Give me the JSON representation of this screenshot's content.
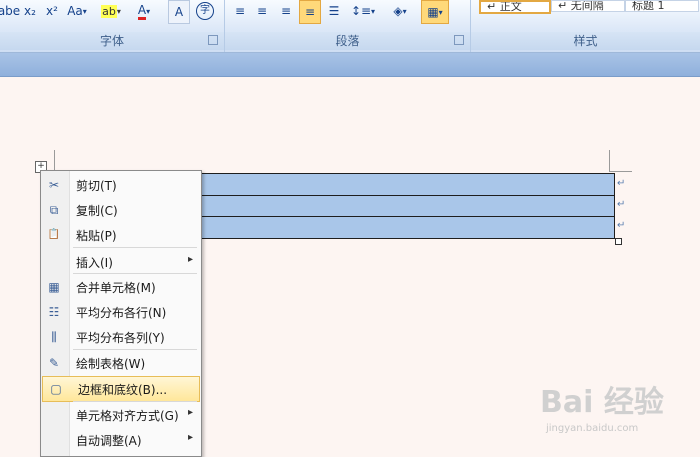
{
  "ribbon": {
    "font_group": {
      "label": "字体",
      "buttons": [
        "abe",
        "x₂",
        "x²",
        "Aa",
        "ab",
        "A",
        "A",
        "字"
      ]
    },
    "paragraph_group": {
      "label": "段落"
    },
    "styles_group": {
      "label": "样式",
      "styles": [
        "↵ 正文",
        "↵ 无间隔",
        "标题 1"
      ]
    }
  },
  "table": {
    "rows": 3,
    "paragraph_mark": "↵",
    "handle_glyph": "+"
  },
  "context_menu": {
    "items": [
      {
        "label": "剪切(T)",
        "icon": "scissors-icon",
        "glyph": "✂"
      },
      {
        "label": "复制(C)",
        "icon": "copy-icon",
        "glyph": "⧉"
      },
      {
        "label": "粘贴(P)",
        "icon": "paste-icon",
        "glyph": "📋"
      },
      {
        "label": "插入(I)",
        "submenu": true
      },
      {
        "label": "合并单元格(M)",
        "icon": "merge-cells-icon",
        "glyph": "▦"
      },
      {
        "label": "平均分布各行(N)",
        "icon": "distribute-rows-icon",
        "glyph": "☷"
      },
      {
        "label": "平均分布各列(Y)",
        "icon": "distribute-columns-icon",
        "glyph": "⫼"
      },
      {
        "label": "绘制表格(W)",
        "icon": "draw-table-icon",
        "glyph": "✎"
      },
      {
        "label": "边框和底纹(B)...",
        "icon": "borders-shading-icon",
        "glyph": "▢",
        "highlighted": true
      },
      {
        "label": "单元格对齐方式(G)",
        "submenu": true
      },
      {
        "label": "自动调整(A)",
        "submenu": true
      }
    ],
    "submenu_arrow": "▸"
  },
  "watermark": {
    "brand": "Bai 经验",
    "url": "jingyan.baidu.com"
  },
  "colors": {
    "ribbon_text": "#15428b",
    "table_fill": "#a9c6e9",
    "menu_highlight": "#ffe79a"
  }
}
